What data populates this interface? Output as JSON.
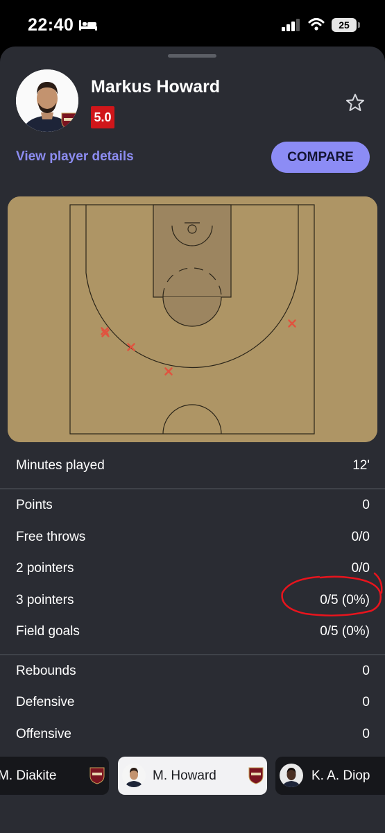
{
  "status_bar": {
    "time": "22:40",
    "battery": "25"
  },
  "player": {
    "name": "Markus Howard",
    "rating": "5.0"
  },
  "actions": {
    "details_link": "View player details",
    "compare_label": "COMPARE"
  },
  "shot_chart": {
    "shots": [
      {
        "result": "miss"
      },
      {
        "result": "miss"
      },
      {
        "result": "miss"
      },
      {
        "result": "miss"
      },
      {
        "result": "miss"
      }
    ]
  },
  "stats": {
    "minutes": {
      "label": "Minutes played",
      "value": "12'"
    },
    "scoring": [
      {
        "label": "Points",
        "value": "0"
      },
      {
        "label": "Free throws",
        "value": "0/0"
      },
      {
        "label": "2 pointers",
        "value": "0/0"
      },
      {
        "label": "3 pointers",
        "value": "0/5 (0%)"
      },
      {
        "label": "Field goals",
        "value": "0/5 (0%)"
      }
    ],
    "rebounds": [
      {
        "label": "Rebounds",
        "value": "0"
      },
      {
        "label": "Defensive",
        "value": "0"
      },
      {
        "label": "Offensive",
        "value": "0"
      }
    ]
  },
  "player_switcher": [
    {
      "name": "M. Diakite",
      "selected": false
    },
    {
      "name": "M. Howard",
      "selected": true
    },
    {
      "name": "K. A. Diop",
      "selected": false
    }
  ],
  "colors": {
    "sheet_bg": "#2a2c33",
    "accent": "#8c8cf5",
    "rating_bg": "#d0161a",
    "court": "#ae9565",
    "paint": "#9c8560",
    "miss_marker": "#e0533f",
    "annotation": "#e8141d"
  },
  "icons": [
    "bed-icon",
    "signal-icon",
    "wifi-icon",
    "star-icon",
    "team-badge-icon",
    "miss-marker-icon"
  ]
}
